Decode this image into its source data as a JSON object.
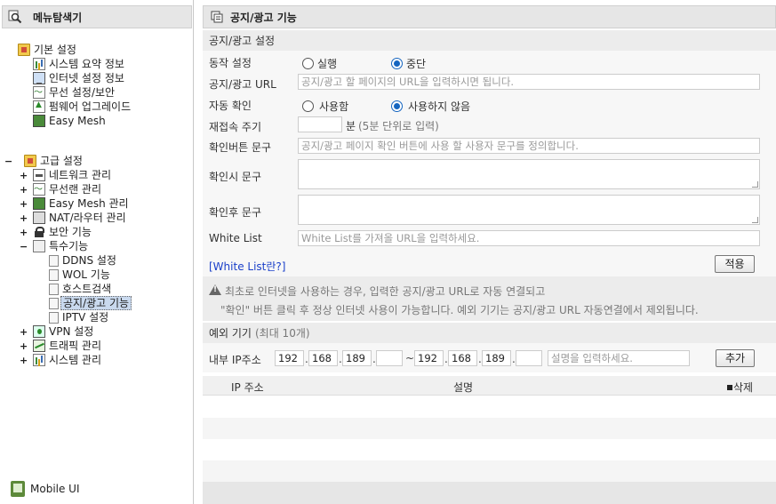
{
  "sidebar": {
    "title": "메뉴탐색기",
    "basic": {
      "label": "기본 설정",
      "items": [
        "시스템 요약 정보",
        "인터넷 설정 정보",
        "무선 설정/보안",
        "펌웨어 업그레이드",
        "Easy Mesh"
      ]
    },
    "advanced": {
      "label": "고급 설정",
      "expand": "−",
      "items": [
        {
          "label": "네트워크 관리",
          "expand": "+"
        },
        {
          "label": "무선랜 관리",
          "expand": "+"
        },
        {
          "label": "Easy Mesh 관리",
          "expand": "+"
        },
        {
          "label": "NAT/라우터 관리",
          "expand": "+"
        },
        {
          "label": "보안 기능",
          "expand": "+"
        },
        {
          "label": "특수기능",
          "expand": "−"
        }
      ],
      "special_children": [
        "DDNS 설정",
        "WOL 기능",
        "호스트검색",
        "공지/광고 기능",
        "IPTV 설정"
      ],
      "tail": [
        {
          "label": "VPN 설정",
          "expand": "+"
        },
        {
          "label": "트래픽 관리",
          "expand": "+"
        },
        {
          "label": "시스템 관리",
          "expand": "+"
        }
      ]
    },
    "basic_expand": "",
    "mobile_ui": "Mobile UI"
  },
  "main": {
    "title": "공지/광고 기능",
    "settings_section": "공지/광고 설정",
    "operation": {
      "label": "동작 설정",
      "options": [
        "실행",
        "중단"
      ],
      "selected": "중단"
    },
    "url": {
      "label": "공지/광고 URL",
      "placeholder": "공지/광고 할 페이지의 URL을 입력하시면 됩니다."
    },
    "auto_confirm": {
      "label": "자동 확인",
      "options": [
        "사용함",
        "사용하지 않음"
      ],
      "selected": "사용하지 않음"
    },
    "reconnect": {
      "label": "재접속 주기",
      "value": "",
      "unit": "분",
      "hint": "(5분 단위로 입력)"
    },
    "confirm_button_text": {
      "label": "확인버튼 문구",
      "placeholder": "공지/광고 페이지 확인 버튼에 사용 할 사용자 문구를 정의합니다."
    },
    "on_confirm_text": {
      "label": "확인시 문구"
    },
    "after_confirm_text": {
      "label": "확인후 문구"
    },
    "whitelist": {
      "label": "White List",
      "placeholder": "White List를 가져올 URL을 입력하세요."
    },
    "whitelist_help": "[White List란?]",
    "apply_button": "적용",
    "notice_line1": "최초로 인터넷을 사용하는 경우, 입력한 공지/광고 URL로 자동 연결되고",
    "notice_line2": "\"확인\" 버튼 클릭 후 정상 인터넷 사용이 가능합니다. 예외 기기는 공지/광고 URL 자동연결에서 제외됩니다.",
    "exception_section": "예외 기기",
    "exception_section_sub": "(최대 10개)",
    "internal_ip": {
      "label": "내부 IP주소",
      "from": [
        "192",
        "168",
        "189",
        ""
      ],
      "tilde": "~",
      "to": [
        "192",
        "168",
        "189",
        ""
      ],
      "desc_placeholder": "설명을 입력하세요.",
      "add_button": "추가"
    },
    "table": {
      "col_ip": "IP 주소",
      "col_desc": "설명",
      "col_delete": "삭제"
    }
  }
}
